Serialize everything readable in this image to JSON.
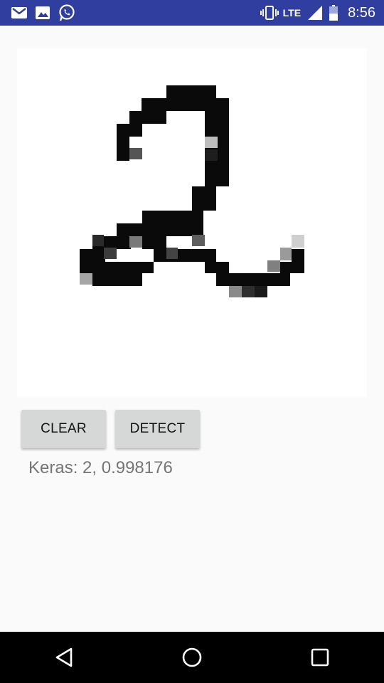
{
  "status_bar": {
    "time": "8:56",
    "network": "LTE",
    "icons": [
      "gmail-icon",
      "gallery-icon",
      "whatsapp-icon",
      "vibrate-icon",
      "signal-icon",
      "battery-icon"
    ]
  },
  "buttons": {
    "clear_label": "CLEAR",
    "detect_label": "DETECT"
  },
  "result": {
    "text": "Keras: 2, 0.998176"
  },
  "nav": {
    "icons": [
      "back-icon",
      "home-icon",
      "recents-icon"
    ]
  },
  "colors": {
    "status_bar": "#303f9f",
    "background": "#fafafa",
    "button": "#d6d7d7",
    "result_text": "#757575"
  }
}
